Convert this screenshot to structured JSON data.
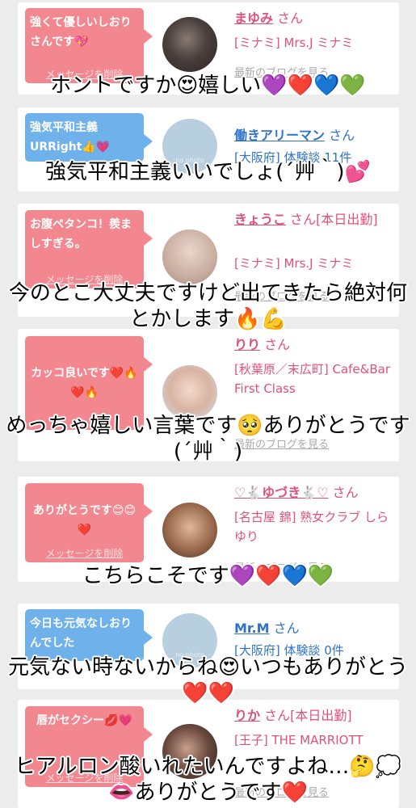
{
  "ui": {
    "delete_label": "メッセージを削除",
    "blog_label": "最新のブログを見る",
    "san": "さん",
    "no_photo": "no photo"
  },
  "cards": [
    {
      "message": "強くて優しいしおりさんです💖",
      "name": "まゆみ",
      "suffix": "",
      "info": "[ミナミ] Mrs.J ミナミ",
      "reply": "ホントですか😍嬉しい💜❤️💙💚"
    },
    {
      "message": "強気平和主義URRight👍💗",
      "name": "働きアリーマン",
      "suffix": "",
      "info": "[大阪府] 体験談 11件",
      "reply": "強気平和主義いいでしょ(´艸｀)💕"
    },
    {
      "message": "お腹ペタンコ！羨ましすぎる。",
      "name": "きょうこ",
      "suffix": "[本日出勤]",
      "info": "[ミナミ] Mrs.J ミナミ",
      "reply": "今のとこ大丈夫ですけど出てきたら絶対何とかします🔥💪"
    },
    {
      "message": "カッコ良いです❤️🔥❤️🔥",
      "name": "りり",
      "suffix": "",
      "info": "[秋葉原／末広町] Cafe&Bar First Class",
      "reply": "めっちゃ嬉しい言葉です🥺ありがとうです(´艸｀)"
    },
    {
      "message": "ありがとうです😊😊❤️",
      "name": "♡🐇ゆづき🐇♡",
      "suffix": "",
      "info": "[名古屋 錦] 熟女クラブ しらゆり",
      "reply": "こちらこそです💜❤️💙💚"
    },
    {
      "message": "今日も元気なしおりんでした",
      "name": "Mr.M",
      "suffix": "",
      "info": "[大阪府] 体験談 0件",
      "reply": "元気ない時ないからね😍いつもありがとう❤️❤️"
    },
    {
      "message": "唇がセクシー💋💗",
      "name": "りか",
      "suffix": "[本日出勤]",
      "info": "[王子] THE MARRIOTT",
      "reply": "ヒアルロン酸いれたいんですよね…🤔💭👄ありがとうです❤️"
    }
  ]
}
